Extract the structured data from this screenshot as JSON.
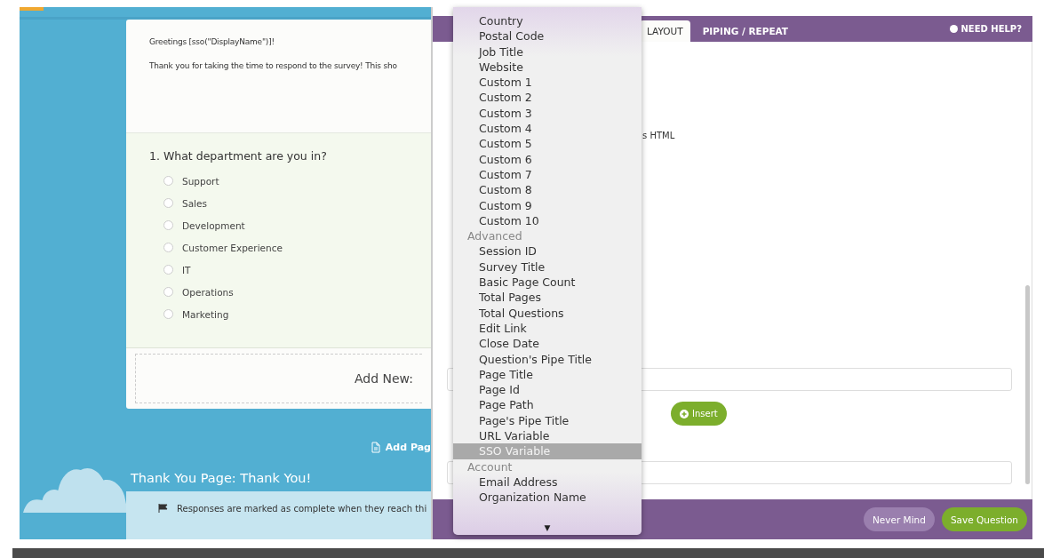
{
  "survey": {
    "intro": [
      "Greetings [sso(\"DisplayName\")]!",
      "Thank you for taking the time to respond to the survey! This sho"
    ],
    "question": {
      "title": "1. What department are you in?",
      "options": [
        {
          "label": "Support",
          "selected": false
        },
        {
          "label": "Sales",
          "selected": false
        },
        {
          "label": "Development",
          "selected": false
        },
        {
          "label": "Customer Experience",
          "selected": false
        },
        {
          "label": "IT",
          "selected": false
        },
        {
          "label": "Operations",
          "selected": false
        },
        {
          "label": "Marketing",
          "selected": false
        }
      ]
    },
    "add_new": "Add New:",
    "add_page": "Add Pag",
    "thank_you_title": "Thank You Page: Thank You!",
    "thank_you_note": "Responses are marked as complete when they reach thi"
  },
  "editor": {
    "tabs": [
      {
        "label": "LAYOUT",
        "selected": true
      },
      {
        "label": "PIPING / REPEAT",
        "selected": false
      }
    ],
    "help": "NEED HELP?",
    "partial_text": "s HTML",
    "insert_button": "Insert",
    "buttons": [
      {
        "label": "Never Mind",
        "kind": "secondary"
      },
      {
        "label": "Save Question",
        "kind": "primary"
      }
    ]
  },
  "dropdown": {
    "items": [
      {
        "label": "Country",
        "kind": "option",
        "selected": false
      },
      {
        "label": "Postal Code",
        "kind": "option",
        "selected": false
      },
      {
        "label": "Job Title",
        "kind": "option",
        "selected": false
      },
      {
        "label": "Website",
        "kind": "option",
        "selected": false
      },
      {
        "label": "Custom 1",
        "kind": "option",
        "selected": false
      },
      {
        "label": "Custom 2",
        "kind": "option",
        "selected": false
      },
      {
        "label": "Custom 3",
        "kind": "option",
        "selected": false
      },
      {
        "label": "Custom 4",
        "kind": "option",
        "selected": false
      },
      {
        "label": "Custom 5",
        "kind": "option",
        "selected": false
      },
      {
        "label": "Custom 6",
        "kind": "option",
        "selected": false
      },
      {
        "label": "Custom 7",
        "kind": "option",
        "selected": false
      },
      {
        "label": "Custom 8",
        "kind": "option",
        "selected": false
      },
      {
        "label": "Custom 9",
        "kind": "option",
        "selected": false
      },
      {
        "label": "Custom 10",
        "kind": "option",
        "selected": false
      },
      {
        "label": "Advanced",
        "kind": "group"
      },
      {
        "label": "Session ID",
        "kind": "option",
        "selected": false
      },
      {
        "label": "Survey Title",
        "kind": "option",
        "selected": false
      },
      {
        "label": "Basic Page Count",
        "kind": "option",
        "selected": false
      },
      {
        "label": "Total Pages",
        "kind": "option",
        "selected": false
      },
      {
        "label": "Total Questions",
        "kind": "option",
        "selected": false
      },
      {
        "label": "Edit Link",
        "kind": "option",
        "selected": false
      },
      {
        "label": "Close Date",
        "kind": "option",
        "selected": false
      },
      {
        "label": "Question's Pipe Title",
        "kind": "option",
        "selected": false
      },
      {
        "label": "Page Title",
        "kind": "option",
        "selected": false
      },
      {
        "label": "Page Id",
        "kind": "option",
        "selected": false
      },
      {
        "label": "Page Path",
        "kind": "option",
        "selected": false
      },
      {
        "label": "Page's Pipe Title",
        "kind": "option",
        "selected": false
      },
      {
        "label": "URL Variable",
        "kind": "option",
        "selected": false
      },
      {
        "label": "SSO Variable",
        "kind": "option",
        "selected": true
      },
      {
        "label": "Account",
        "kind": "group"
      },
      {
        "label": "Email Address",
        "kind": "option",
        "selected": false
      },
      {
        "label": "Organization Name",
        "kind": "option",
        "selected": false
      }
    ],
    "scroll_arrow": "▼"
  }
}
